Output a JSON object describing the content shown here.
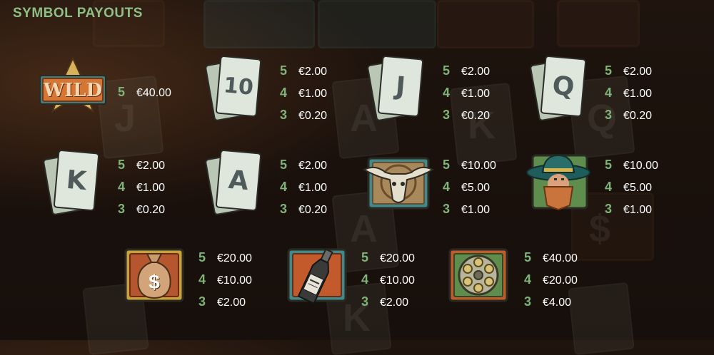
{
  "title": "SYMBOL PAYOUTS",
  "symbols": [
    {
      "name": "Wild",
      "badge_text": "WILD",
      "payouts": [
        {
          "count": "5",
          "amount": "€40.00"
        }
      ]
    },
    {
      "name": "10",
      "card_label": "10",
      "payouts": [
        {
          "count": "5",
          "amount": "€2.00"
        },
        {
          "count": "4",
          "amount": "€1.00"
        },
        {
          "count": "3",
          "amount": "€0.20"
        }
      ]
    },
    {
      "name": "J",
      "card_label": "J",
      "payouts": [
        {
          "count": "5",
          "amount": "€2.00"
        },
        {
          "count": "4",
          "amount": "€1.00"
        },
        {
          "count": "3",
          "amount": "€0.20"
        }
      ]
    },
    {
      "name": "Q",
      "card_label": "Q",
      "payouts": [
        {
          "count": "5",
          "amount": "€2.00"
        },
        {
          "count": "4",
          "amount": "€1.00"
        },
        {
          "count": "3",
          "amount": "€0.20"
        }
      ]
    },
    {
      "name": "K",
      "card_label": "K",
      "payouts": [
        {
          "count": "5",
          "amount": "€2.00"
        },
        {
          "count": "4",
          "amount": "€1.00"
        },
        {
          "count": "3",
          "amount": "€0.20"
        }
      ]
    },
    {
      "name": "A",
      "card_label": "A",
      "payouts": [
        {
          "count": "5",
          "amount": "€2.00"
        },
        {
          "count": "4",
          "amount": "€1.00"
        },
        {
          "count": "3",
          "amount": "€0.20"
        }
      ]
    },
    {
      "name": "Bull skull",
      "payouts": [
        {
          "count": "5",
          "amount": "€10.00"
        },
        {
          "count": "4",
          "amount": "€5.00"
        },
        {
          "count": "3",
          "amount": "€1.00"
        }
      ]
    },
    {
      "name": "Bandit",
      "payouts": [
        {
          "count": "5",
          "amount": "€10.00"
        },
        {
          "count": "4",
          "amount": "€5.00"
        },
        {
          "count": "3",
          "amount": "€1.00"
        }
      ]
    },
    {
      "name": "Money bag",
      "bag_symbol": "$",
      "payouts": [
        {
          "count": "5",
          "amount": "€20.00"
        },
        {
          "count": "4",
          "amount": "€10.00"
        },
        {
          "count": "3",
          "amount": "€2.00"
        }
      ]
    },
    {
      "name": "Whiskey",
      "payouts": [
        {
          "count": "5",
          "amount": "€20.00"
        },
        {
          "count": "4",
          "amount": "€10.00"
        },
        {
          "count": "3",
          "amount": "€2.00"
        }
      ]
    },
    {
      "name": "Revolver cylinder",
      "payouts": [
        {
          "count": "5",
          "amount": "€40.00"
        },
        {
          "count": "4",
          "amount": "€20.00"
        },
        {
          "count": "3",
          "amount": "€4.00"
        }
      ]
    }
  ],
  "background_glyphs": [
    "J",
    "A",
    "Q",
    "K",
    "$",
    "A",
    "K"
  ],
  "colors": {
    "title": "#8fbf86",
    "count": "#7fb377",
    "amount": "#ffffff",
    "background": "#1a110c"
  }
}
